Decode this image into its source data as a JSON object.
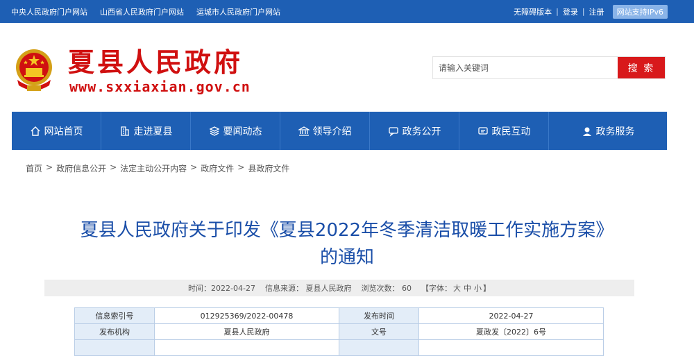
{
  "topbar": {
    "links": [
      "中央人民政府门户网站",
      "山西省人民政府门户网站",
      "运城市人民政府门户网站"
    ],
    "accessible": "无障碍版本",
    "login": "登录",
    "register": "注册",
    "sep": "|",
    "ipv6": "网站支持IPv6"
  },
  "header": {
    "site_name": "夏县人民政府",
    "site_url": "www.sxxiaxian.gov.cn",
    "search_placeholder": "请输入关键词",
    "search_button": "搜 索"
  },
  "nav": [
    {
      "label": "网站首页",
      "icon": "home-icon"
    },
    {
      "label": "走进夏县",
      "icon": "building-icon"
    },
    {
      "label": "要闻动态",
      "icon": "layers-icon"
    },
    {
      "label": "领导介绍",
      "icon": "bank-icon"
    },
    {
      "label": "政务公开",
      "icon": "chat-icon"
    },
    {
      "label": "政民互动",
      "icon": "message-icon"
    },
    {
      "label": "政务服务",
      "icon": "user-icon"
    }
  ],
  "breadcrumb": [
    "首页",
    "政府信息公开",
    "法定主动公开内容",
    "政府文件",
    "县政府文件"
  ],
  "article": {
    "title_line1": "夏县人民政府关于印发《夏县2022年冬季清洁取暖工作实施方案》",
    "title_line2": "的通知",
    "time": "时间：2022-04-27",
    "source": "信息来源： 夏县人民政府",
    "views": "浏览次数： 60",
    "font_label": "【字体：",
    "font_large": "大",
    "font_medium": "中",
    "font_small": "小",
    "font_end": "】"
  },
  "info_table": [
    {
      "l1": "信息索引号",
      "v1": "012925369/2022-00478",
      "l2": "发布时间",
      "v2": "2022-04-27"
    },
    {
      "l1": "发布机构",
      "v1": "夏县人民政府",
      "l2": "文号",
      "v2": "夏政发〔2022〕6号"
    }
  ],
  "colors": {
    "primary": "#1e5fb4",
    "red": "#d01010",
    "title": "#1a4ea8"
  }
}
